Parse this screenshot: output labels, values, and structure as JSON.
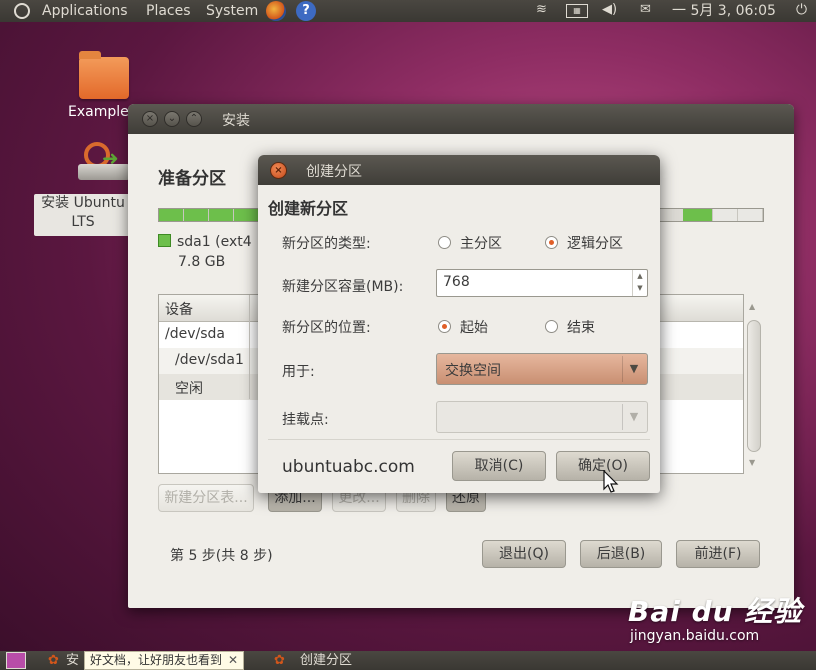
{
  "top_panel": {
    "menus": [
      "Applications",
      "Places",
      "System"
    ],
    "clock": "一 5月  3, 06:05",
    "icons": [
      "ubuntu-logo-icon",
      "firefox-icon",
      "help-icon",
      "network-icon",
      "keyboard-icon",
      "volume-icon",
      "mail-icon",
      "power-icon"
    ]
  },
  "desktop": {
    "examples_label": "Example",
    "installer_label": "安装 Ubuntu\nLTS",
    "installer_line1": "安装 Ubuntu",
    "installer_line2": "LTS"
  },
  "main_window": {
    "title": "安装",
    "heading": "准备分区",
    "legend_name": "sda1 (ext4",
    "legend_size": "7.8 GB",
    "table_header": "设备",
    "rows": [
      "/dev/sda",
      "/dev/sda1",
      "空闲"
    ],
    "buttons": {
      "new_table": "新建分区表...",
      "add": "添加...",
      "change": "更改...",
      "delete": "删除",
      "revert": "还原"
    },
    "step": "第 5 步(共 8 步)",
    "nav": {
      "quit": "退出(Q)",
      "back": "后退(B)",
      "forward": "前进(F)"
    }
  },
  "dialog": {
    "title": "创建分区",
    "heading": "创建新分区",
    "type_label": "新分区的类型:",
    "type_options": [
      "主分区",
      "逻辑分区"
    ],
    "type_selected": "逻辑分区",
    "size_label": "新建分区容量(MB):",
    "size_value": "768",
    "position_label": "新分区的位置:",
    "position_options": [
      "起始",
      "结束"
    ],
    "position_selected": "起始",
    "use_label": "用于:",
    "use_value": "交换空间",
    "mount_label": "挂载点:",
    "mount_value": "",
    "watermark": "ubuntuabc.com",
    "cancel": "取消(C)",
    "ok": "确定(O)"
  },
  "bottom_panel": {
    "tooltip": "好文档，让好朋友也看到",
    "task": "创建分区",
    "task_short": "安"
  },
  "baidu": {
    "logo": "Bai du 经验",
    "url": "jingyan.baidu.com"
  },
  "colors": {
    "accent": "#e05f28",
    "panel": "#3f3d38",
    "progress": "#6dbf4b"
  }
}
